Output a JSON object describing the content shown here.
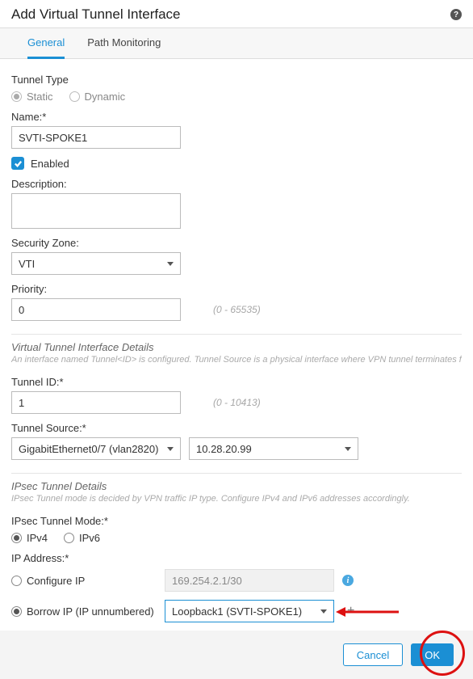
{
  "header": {
    "title": "Add Virtual Tunnel Interface"
  },
  "tabs": {
    "general": "General",
    "path": "Path Monitoring"
  },
  "tunnel_type": {
    "label": "Tunnel Type",
    "static": "Static",
    "dynamic": "Dynamic"
  },
  "name": {
    "label": "Name:*",
    "value": "SVTI-SPOKE1"
  },
  "enabled": {
    "label": "Enabled"
  },
  "description": {
    "label": "Description:",
    "value": ""
  },
  "security_zone": {
    "label": "Security Zone:",
    "value": "VTI"
  },
  "priority": {
    "label": "Priority:",
    "value": "0",
    "hint": "(0 - 65535)"
  },
  "vti": {
    "title": "Virtual Tunnel Interface Details",
    "desc": "An interface named Tunnel<ID> is configured. Tunnel Source is a physical interface where VPN tunnel terminates for the VTI.",
    "tunnel_id": {
      "label": "Tunnel ID:*",
      "value": "1",
      "hint": "(0 - 10413)"
    },
    "tunnel_source": {
      "label": "Tunnel Source:*",
      "iface": "GigabitEthernet0/7 (vlan2820)",
      "ip": "10.28.20.99"
    }
  },
  "ipsec": {
    "title": "IPsec Tunnel Details",
    "desc": "IPsec Tunnel mode is decided by VPN traffic IP type. Configure IPv4 and IPv6 addresses accordingly.",
    "mode_label": "IPsec Tunnel Mode:*",
    "ipv4": "IPv4",
    "ipv6": "IPv6",
    "ip_label": "IP Address:*",
    "configure": "Configure IP",
    "configure_val": "169.254.2.1/30",
    "borrow": "Borrow IP (IP unnumbered)",
    "borrow_val": "Loopback1 (SVTI-SPOKE1)"
  },
  "footer": {
    "cancel": "Cancel",
    "ok": "OK"
  }
}
